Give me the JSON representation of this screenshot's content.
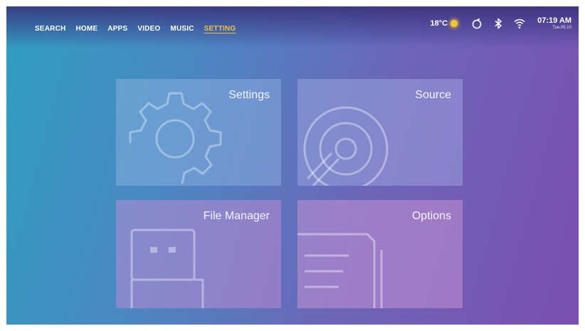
{
  "nav": {
    "items": [
      {
        "label": "SEARCH"
      },
      {
        "label": "HOME"
      },
      {
        "label": "APPS"
      },
      {
        "label": "VIDEO"
      },
      {
        "label": "MUSIC"
      },
      {
        "label": "SETTING"
      }
    ],
    "active": "SETTING"
  },
  "status": {
    "temperature": "18°C",
    "weather_icon": "sun-icon",
    "icons": [
      "display-icon",
      "bluetooth-icon",
      "wifi-icon"
    ],
    "time": "07:19 AM",
    "date": "Tue.05.10"
  },
  "tiles": [
    {
      "label": "Settings",
      "icon": "gear-icon"
    },
    {
      "label": "Source",
      "icon": "source-icon"
    },
    {
      "label": "File Manager",
      "icon": "usb-drive-icon"
    },
    {
      "label": "Options",
      "icon": "options-document-icon"
    }
  ],
  "colors": {
    "accent": "#f2c23a",
    "background_left": "#2f9fc0",
    "background_right": "#7b4fb0"
  }
}
